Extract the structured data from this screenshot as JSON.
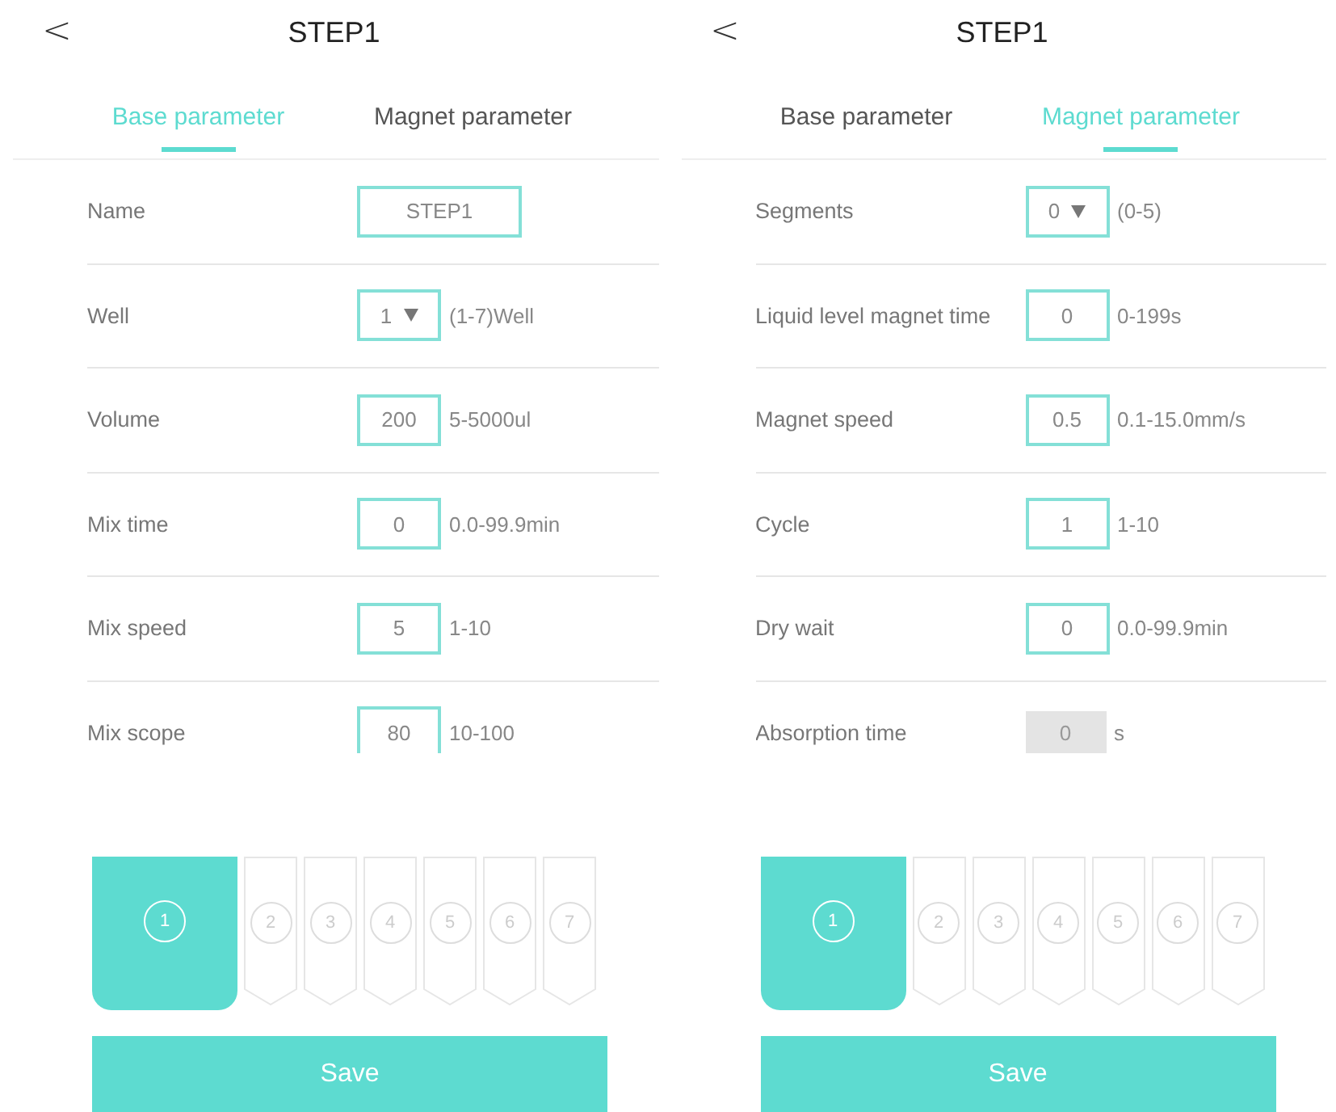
{
  "panels": [
    {
      "back": "<",
      "title": "STEP1",
      "tabs": [
        {
          "label": "Base parameter",
          "selected": true
        },
        {
          "label": "Magnet parameter",
          "selected": false
        }
      ],
      "rows": [
        {
          "kind": "text",
          "label": "Name",
          "value": "STEP1",
          "disabled": false
        },
        {
          "kind": "select",
          "label": "Well",
          "value": "1",
          "hint": "(1-7)Well",
          "disabled": false
        },
        {
          "kind": "number",
          "label": "Volume",
          "value": "200",
          "hint": "5-5000ul",
          "disabled": false
        },
        {
          "kind": "number",
          "label": "Mix time",
          "value": "0",
          "hint": "0.0-99.9min",
          "disabled": false
        },
        {
          "kind": "number",
          "label": "Mix speed",
          "value": "5",
          "hint": "1-10",
          "disabled": false
        },
        {
          "kind": "number",
          "label": "Mix scope",
          "value": "80",
          "hint": "10-100",
          "disabled": false
        }
      ],
      "wells": [
        {
          "label": "1",
          "selected": true
        },
        {
          "label": "2",
          "selected": false
        },
        {
          "label": "3",
          "selected": false
        },
        {
          "label": "4",
          "selected": false
        },
        {
          "label": "5",
          "selected": false
        },
        {
          "label": "6",
          "selected": false
        },
        {
          "label": "7",
          "selected": false
        }
      ],
      "save": "Save"
    },
    {
      "back": "<",
      "title": "STEP1",
      "tabs": [
        {
          "label": "Base parameter",
          "selected": false
        },
        {
          "label": "Magnet parameter",
          "selected": true
        }
      ],
      "rows": [
        {
          "kind": "select",
          "label": "Segments",
          "value": "0",
          "hint": "(0-5)",
          "disabled": false
        },
        {
          "kind": "number",
          "label": "Liquid level magnet time",
          "value": "0",
          "hint": "0-199s",
          "disabled": false
        },
        {
          "kind": "number",
          "label": "Magnet speed",
          "value": "0.5",
          "hint": "0.1-15.0mm/s",
          "disabled": false
        },
        {
          "kind": "number",
          "label": "Cycle",
          "value": "1",
          "hint": "1-10",
          "disabled": false
        },
        {
          "kind": "number",
          "label": "Dry wait",
          "value": "0",
          "hint": "0.0-99.9min",
          "disabled": false
        },
        {
          "kind": "number",
          "label": "Absorption time",
          "value": "0",
          "hint": "s",
          "disabled": true
        }
      ],
      "wells": [
        {
          "label": "1",
          "selected": true
        },
        {
          "label": "2",
          "selected": false
        },
        {
          "label": "3",
          "selected": false
        },
        {
          "label": "4",
          "selected": false
        },
        {
          "label": "5",
          "selected": false
        },
        {
          "label": "6",
          "selected": false
        },
        {
          "label": "7",
          "selected": false
        }
      ],
      "save": "Save"
    }
  ]
}
